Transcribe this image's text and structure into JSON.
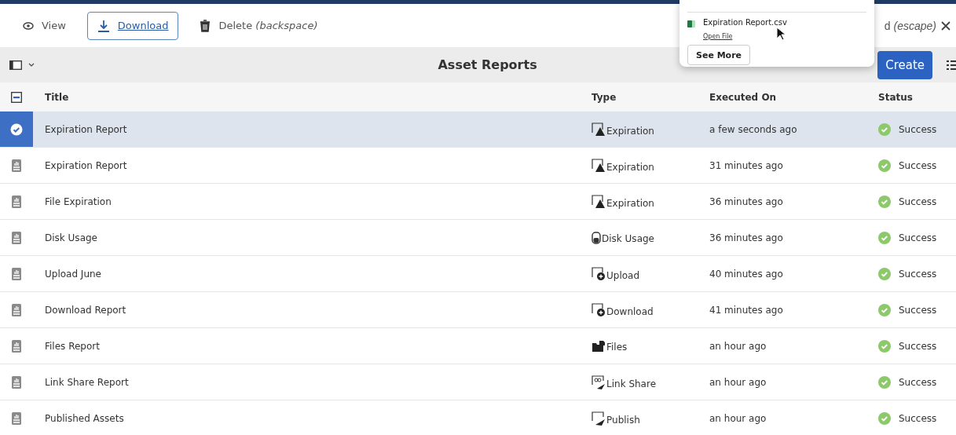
{
  "action_bar": {
    "actions": [
      {
        "kind": "view",
        "label": "View",
        "selected": false
      },
      {
        "kind": "download",
        "label": "Download",
        "selected": true
      },
      {
        "kind": "delete",
        "label": "Delete *(backspace)*",
        "selected": false
      }
    ],
    "close_hint": "d *(escape)*"
  },
  "downloads_popup": {
    "file_name": "Expiration Report.csv",
    "open_link": "Open File",
    "see_more": "See More"
  },
  "header": {
    "title": "Asset Reports",
    "create_button": "Create"
  },
  "table": {
    "select_all": {
      "indeterminate": true
    },
    "columns": [
      "Title",
      "Type",
      "Executed On",
      "Status"
    ],
    "rows": [
      {
        "title": "Expiration Report",
        "kind": "expiration",
        "type": "Expiration",
        "executed": "a few seconds ago",
        "status": "Success",
        "selected": true
      },
      {
        "title": "Expiration Report",
        "kind": "expiration",
        "type": "Expiration",
        "executed": "31 minutes ago",
        "status": "Success",
        "selected": false
      },
      {
        "title": "File Expiration",
        "kind": "expiration",
        "type": "Expiration",
        "executed": "36 minutes ago",
        "status": "Success",
        "selected": false
      },
      {
        "title": "Disk Usage",
        "kind": "disk",
        "type": "Disk Usage",
        "executed": "36 minutes ago",
        "status": "Success",
        "selected": false
      },
      {
        "title": "Upload June",
        "kind": "upload",
        "type": "Upload",
        "executed": "40 minutes ago",
        "status": "Success",
        "selected": false
      },
      {
        "title": "Download Report",
        "kind": "download",
        "type": "Download",
        "executed": "41 minutes ago",
        "status": "Success",
        "selected": false
      },
      {
        "title": "Files Report",
        "kind": "files",
        "type": "Files",
        "executed": "an hour ago",
        "status": "Success",
        "selected": false
      },
      {
        "title": "Link Share Report",
        "kind": "linkshare",
        "type": "Link Share",
        "executed": "an hour ago",
        "status": "Success",
        "selected": false
      },
      {
        "title": "Published Assets",
        "kind": "publish",
        "type": "Publish",
        "executed": "an hour ago",
        "status": "Success",
        "selected": false
      }
    ]
  }
}
